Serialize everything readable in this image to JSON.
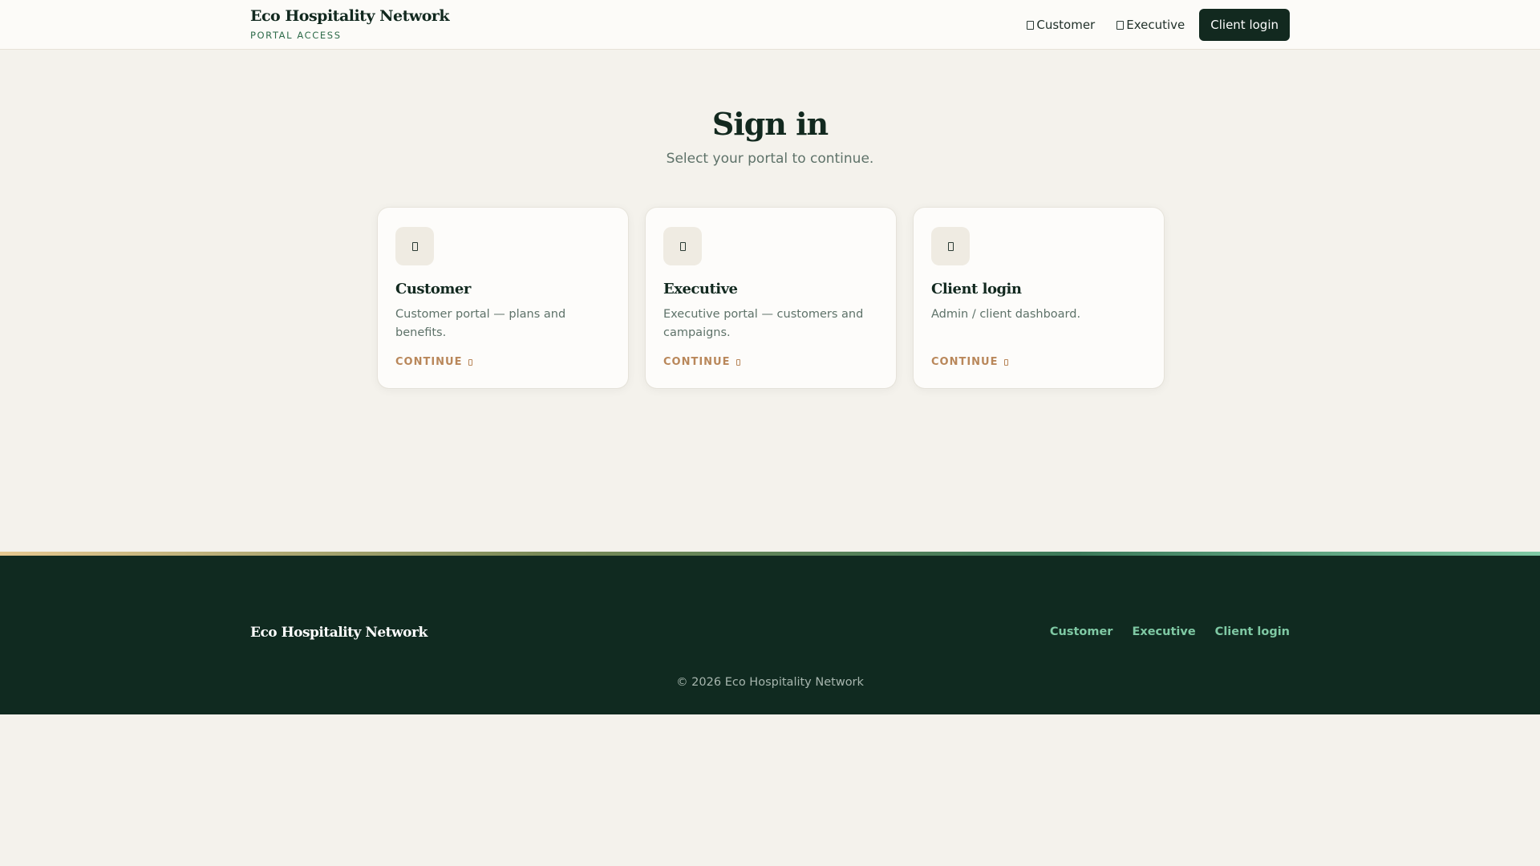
{
  "header": {
    "brand_name": "Eco Hospitality Network",
    "brand_sub": "PORTAL ACCESS",
    "nav": [
      {
        "label": "Customer",
        "icon": "customer-icon"
      },
      {
        "label": "Executive",
        "icon": "executive-icon"
      }
    ],
    "login_button": "Client login"
  },
  "hero": {
    "title": "Sign in",
    "subtitle": "Select your portal to continue."
  },
  "cards": [
    {
      "title": "Customer",
      "description": "Customer portal — plans and benefits.",
      "cta": "CONTINUE",
      "icon": "customer-icon"
    },
    {
      "title": "Executive",
      "description": "Executive portal — customers and campaigns.",
      "cta": "CONTINUE",
      "icon": "executive-icon"
    },
    {
      "title": "Client login",
      "description": "Admin / client dashboard.",
      "cta": "CONTINUE",
      "icon": "client-icon"
    }
  ],
  "footer": {
    "brand": "Eco Hospitality Network",
    "links": [
      "Customer",
      "Executive",
      "Client login"
    ],
    "copyright": "© 2026 Eco Hospitality Network"
  },
  "colors": {
    "primary_dark": "#12291f",
    "footer_bg": "#102a20",
    "accent_link": "#7fc9a4",
    "cta": "#b9875a",
    "page_bg": "#f4f2ec"
  }
}
